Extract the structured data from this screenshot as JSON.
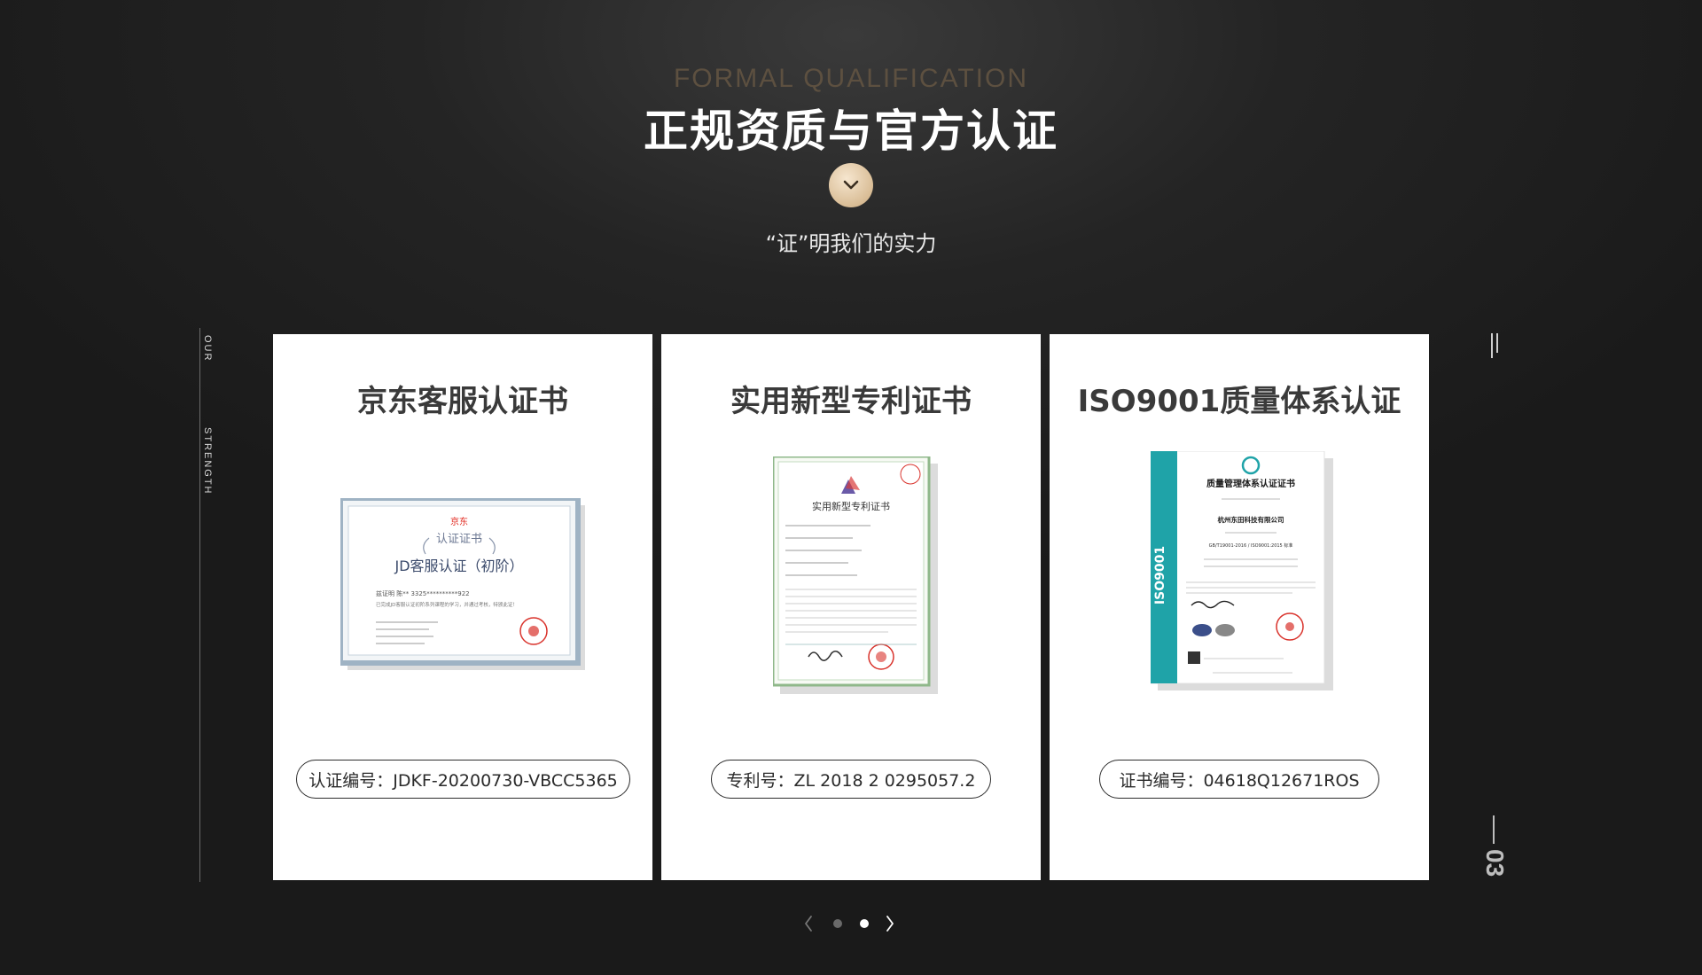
{
  "section": {
    "eyebrow": "FORMAL QUALIFICATION",
    "title": "正规资质与官方认证",
    "subtitle": "“证”明我们的实力"
  },
  "side": {
    "label_top": "OUR",
    "label_bottom": "STRENGTH",
    "page_number": "03"
  },
  "cards": [
    {
      "title": "京东客服认证书",
      "code": "认证编号：JDKF-20200730-VBCC5365",
      "cert": {
        "brand": "京东",
        "heading": "认证证书",
        "name": "JD客服认证（初阶）",
        "holder_line": "兹证明 陈**  3325**********922",
        "desc_line": "已完成JD客服认证初阶系列课程的学习，并通过考核，特颁此证！"
      }
    },
    {
      "title": "实用新型专利证书",
      "code": "专利号：ZL 2018 2 0295057.2",
      "cert": {
        "heading": "实用新型专利证书"
      }
    },
    {
      "title": "ISO9001质量体系认证",
      "code": "证书编号：04618Q12671ROS",
      "cert": {
        "heading": "质量管理体系认证证书",
        "company": "杭州东田科技有限公司",
        "standard": "GB/T19001-2016 / ISO9001:2015 标准",
        "side_text": "ISO9001"
      }
    }
  ],
  "pager": {
    "active_index": 1,
    "count": 2
  },
  "colors": {
    "gold": "#d9bd96",
    "teal": "#1fa3a8",
    "dark_bg": "#1c1c1c"
  }
}
